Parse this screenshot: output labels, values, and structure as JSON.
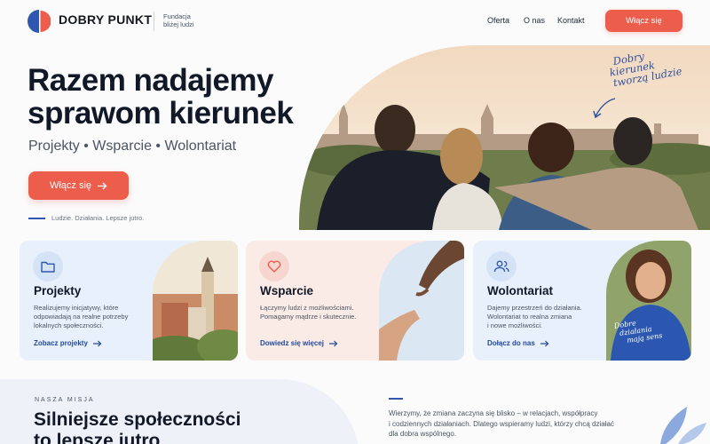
{
  "header": {
    "brand": "DOBRY PUNKT",
    "subtitle_line1": "Fundacja",
    "subtitle_line2": "bliżej ludzi",
    "nav": [
      "Oferta",
      "O nas",
      "Kontakt"
    ],
    "cta": "Włącz się"
  },
  "hero": {
    "title_line1": "Razem nadajemy",
    "title_line2": "sprawom kierunek",
    "subtitle": "Projekty • Wsparcie • Wolontariat",
    "button": "Włącz się",
    "tagline": "Ludzie. Działania. Lepsze jutro.",
    "script_line1": "Dobry",
    "script_line2": "kierunek",
    "script_line3": "tworzą ludzie"
  },
  "cards": [
    {
      "icon": "folder-icon",
      "title": "Projekty",
      "text_line1": "Realizujemy inicjatywy, które",
      "text_line2": "odpowiadają na realne potrzeby",
      "text_line3": "lokalnych społeczności.",
      "link": "Zobacz projekty"
    },
    {
      "icon": "heart-icon",
      "title": "Wsparcie",
      "text_line1": "Łączymy ludzi z możliwościami.",
      "text_line2": "Pomagamy mądrze i skutecznie.",
      "text_line3": "",
      "link": "Dowiedz się więcej"
    },
    {
      "icon": "users-icon",
      "title": "Wolontariat",
      "text_line1": "Dajemy przestrzeń do działania.",
      "text_line2": "Wolontariat to realna zmiana",
      "text_line3": "i nowe możliwości.",
      "link": "Dołącz do nas",
      "shirt_line1": "Dobre",
      "shirt_line2": "działania",
      "shirt_line3": "mają sens"
    }
  ],
  "mission": {
    "label": "NASZA MISJA",
    "title_line1": "Silniejsze społeczności",
    "title_line2": "to lepsze jutro",
    "text_line1": "Wierzymy, że zmiana zaczyna się blisko – w relacjach, współpracy",
    "text_line2": "i codziennych działaniach. Dlatego wspieramy ludzi, którzy chcą działać",
    "text_line3": "dla dobra wspólnego."
  },
  "colors": {
    "accent": "#ec5d4c",
    "brand_blue": "#2f57b0",
    "link_blue": "#234a9b",
    "card_blue": "#e7f0fb",
    "card_pink": "#fbebe6"
  }
}
